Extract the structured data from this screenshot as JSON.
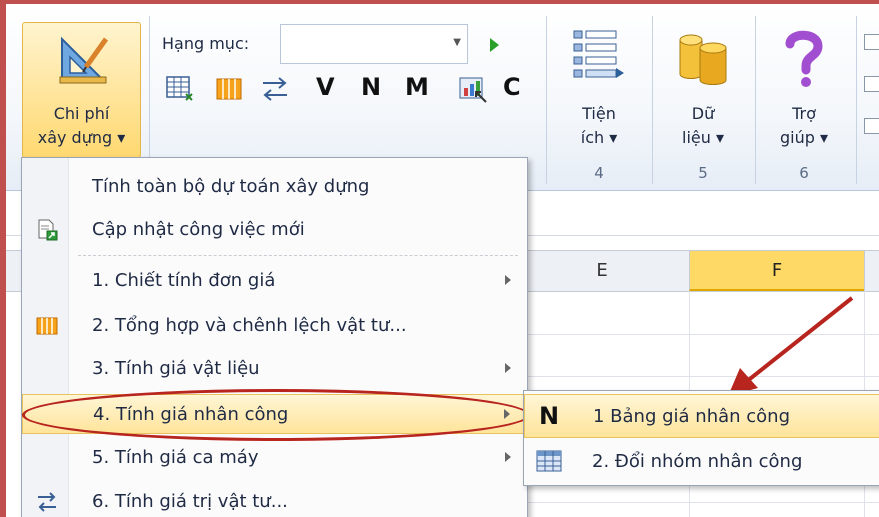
{
  "ribbon": {
    "main_button": {
      "line1": "Chi phí",
      "line2": "xây dựng ▾"
    },
    "category_label": "Hạng mục:",
    "category_value": "",
    "tool_letters": [
      "V",
      "N",
      "M",
      "C"
    ],
    "groups": [
      {
        "line1": "Tiện",
        "line2": "ích ▾",
        "number": "4"
      },
      {
        "line1": "Dữ",
        "line2": "liệu ▾",
        "number": "5"
      },
      {
        "line1": "Trợ",
        "line2": "giúp ▾",
        "number": "6"
      }
    ]
  },
  "sheet": {
    "columns": [
      "E",
      "F"
    ],
    "selected_column": "F"
  },
  "menu": {
    "items": [
      {
        "label": "Tính toàn bộ dự toán xây dựng",
        "icon": "none",
        "has_submenu": false
      },
      {
        "label": "Cập nhật công việc mới",
        "icon": "document-update-icon",
        "has_submenu": false
      },
      {
        "label": "1. Chiết tính đơn giá",
        "icon": "none",
        "has_submenu": true
      },
      {
        "label": "2. Tổng hợp và chênh lệch vật tư...",
        "icon": "columns-icon",
        "has_submenu": false
      },
      {
        "label": "3. Tính giá vật liệu",
        "icon": "none",
        "has_submenu": true
      },
      {
        "label": "4. Tính giá nhân công",
        "icon": "none",
        "has_submenu": true,
        "highlighted": true
      },
      {
        "label": "5. Tính giá ca máy",
        "icon": "none",
        "has_submenu": true
      },
      {
        "label": "6. Tính giá trị vật tư...",
        "icon": "swap-arrows-icon",
        "has_submenu": false
      }
    ]
  },
  "submenu": {
    "items": [
      {
        "label": "1 Bảng giá nhân công",
        "icon_letter": "N",
        "highlighted": true
      },
      {
        "label": "2. Đổi nhóm nhân công",
        "icon": "table-icon"
      }
    ]
  },
  "colors": {
    "highlight": "#ffe49a",
    "annotation_red": "#b8241e",
    "selected_column": "#ffd966"
  }
}
